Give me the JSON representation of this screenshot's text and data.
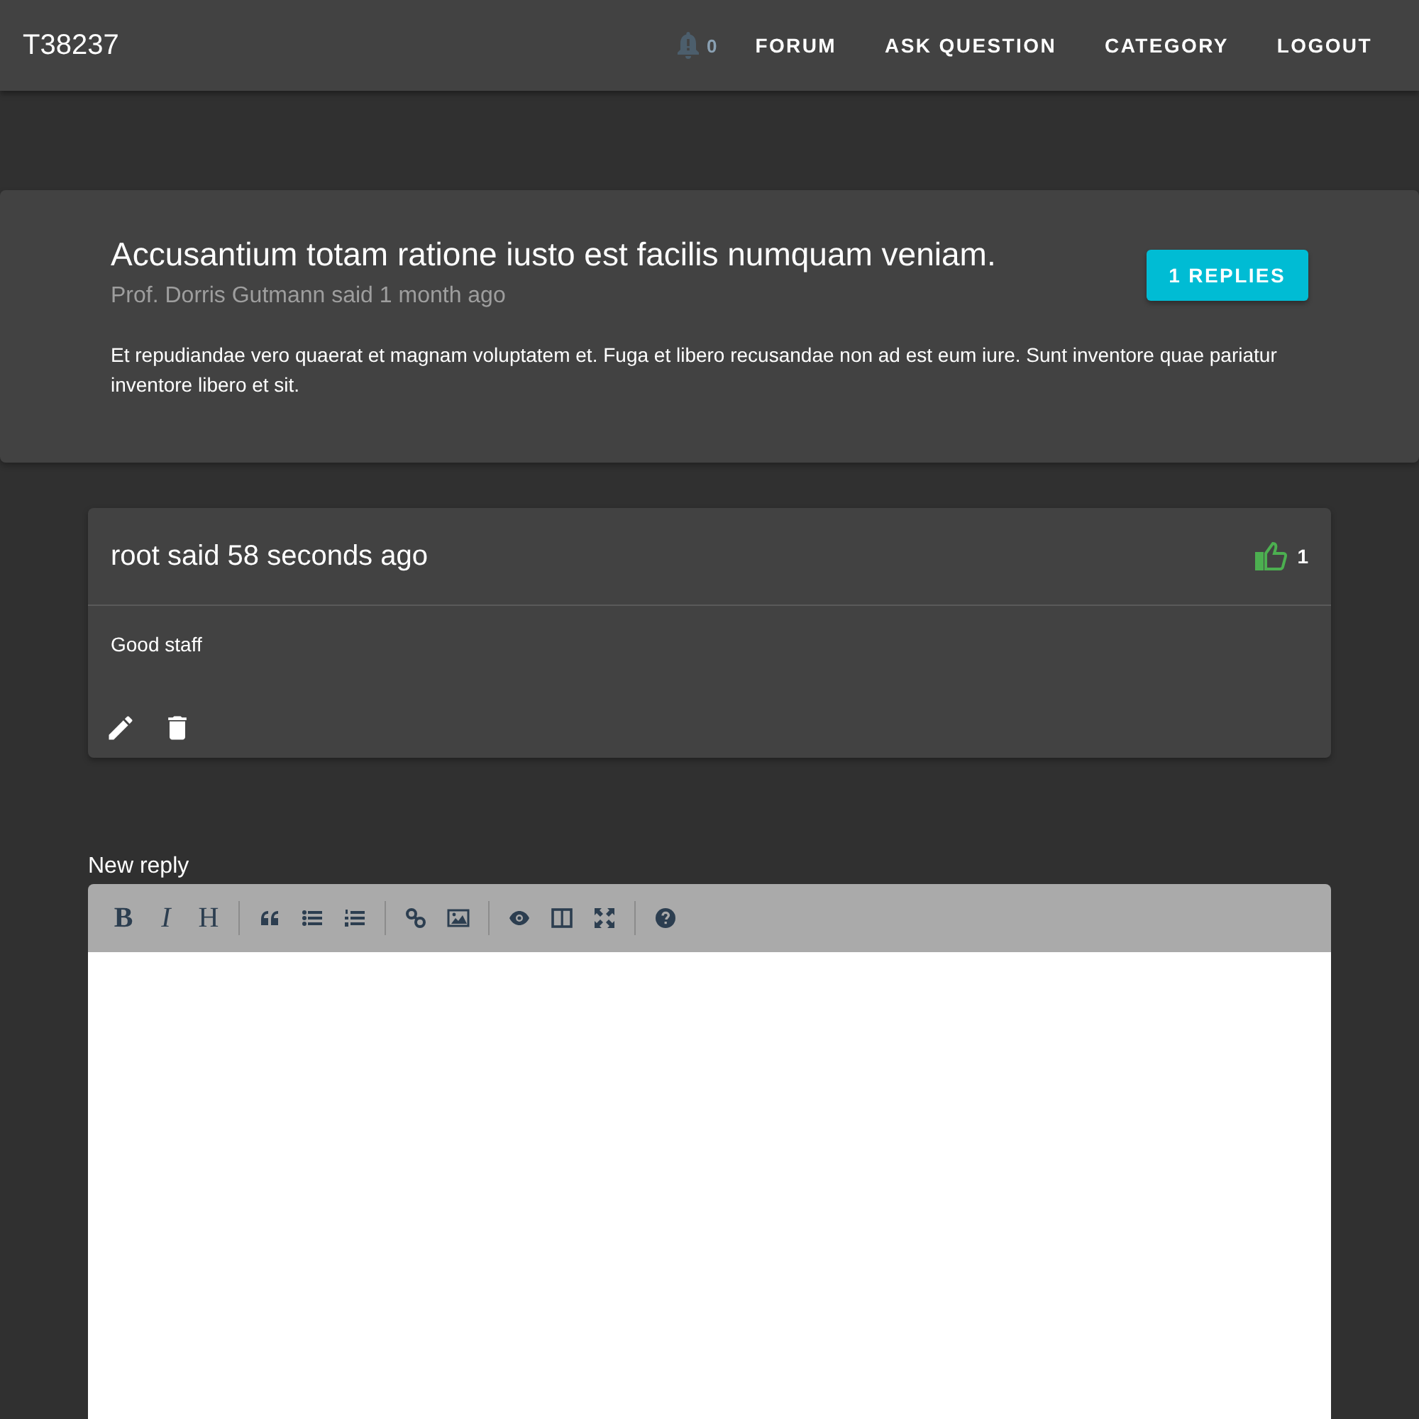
{
  "navbar": {
    "brand": "T38237",
    "notification_count": "0",
    "links": [
      "FORUM",
      "ASK QUESTION",
      "CATEGORY",
      "LOGOUT"
    ]
  },
  "question": {
    "title": "Accusantium totam ratione iusto est facilis numquam veniam.",
    "meta": "Prof. Dorris Gutmann said 1 month ago",
    "replies_button": "1 REPLIES",
    "body": "Et repudiandae vero quaerat et magnam voluptatem et. Fuga et libero recusandae non ad est eum iure. Sunt inventore quae pariatur inventore libero et sit."
  },
  "replies": [
    {
      "header": "root said 58 seconds ago",
      "likes": "1",
      "liked": true,
      "body": "Good staff"
    }
  ],
  "new_reply": {
    "label": "New reply",
    "format_buttons": [
      "B",
      "I",
      "H"
    ]
  }
}
